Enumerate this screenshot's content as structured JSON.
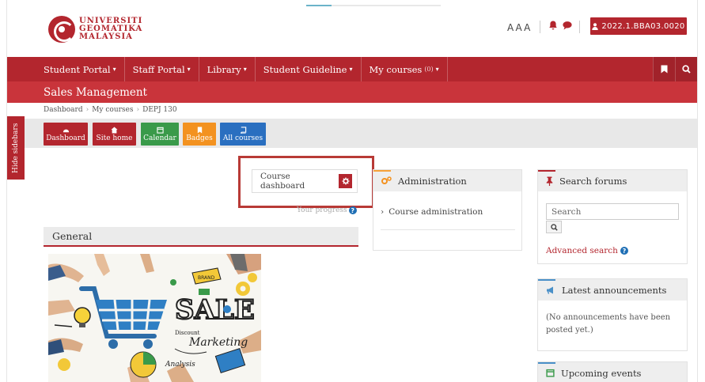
{
  "header": {
    "logo_line1": "UNIVERSITI",
    "logo_line2": "GEOMATIKA",
    "logo_line3": "MALAYSIA",
    "font_sizer": "AAA",
    "user_id": "2022.1.BBA03.0020"
  },
  "nav": {
    "items": [
      {
        "label": "Student Portal"
      },
      {
        "label": "Staff Portal"
      },
      {
        "label": "Library"
      },
      {
        "label": "Student Guideline"
      },
      {
        "label": "My courses",
        "count": "(0)"
      }
    ]
  },
  "course": {
    "title": "Sales Management"
  },
  "breadcrumb": [
    "Dashboard",
    "My courses",
    "DEPJ 130"
  ],
  "quick_links": [
    {
      "label": "Dashboard",
      "color": "#b3262e"
    },
    {
      "label": "Site home",
      "color": "#b3262e"
    },
    {
      "label": "Calendar",
      "color": "#3a9a4a"
    },
    {
      "label": "Badges",
      "color": "#f39220"
    },
    {
      "label": "All courses",
      "color": "#2a6fc0"
    }
  ],
  "sidebar_toggle": "Hide sidebars",
  "main": {
    "course_dashboard": "Course dashboard",
    "progress": "Your progress",
    "section_title": "General"
  },
  "admin_block": {
    "title": "Administration",
    "link": "Course administration"
  },
  "search_block": {
    "title": "Search forums",
    "placeholder": "Search",
    "advanced": "Advanced search"
  },
  "announcements_block": {
    "title": "Latest announcements",
    "body": "(No announcements have been posted yet.)"
  },
  "events_block": {
    "title": "Upcoming events"
  },
  "image_text": {
    "sale": "SALE",
    "marketing": "Marketing",
    "brand": "BRAND",
    "discount": "Discount",
    "analysis": "Analysis"
  },
  "colors": {
    "brand_red": "#b3262e",
    "course_bar": "#c9343b",
    "highlight": "#b83a36"
  }
}
